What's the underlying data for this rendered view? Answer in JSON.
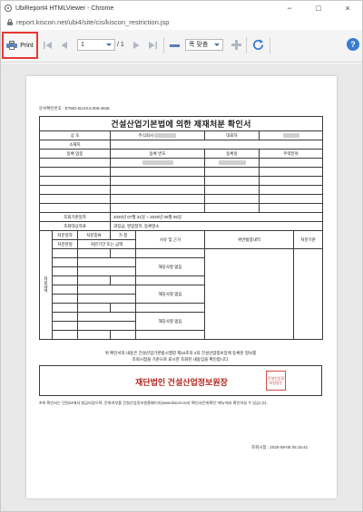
{
  "window": {
    "title": "UbiReport4 HTMLViewer - Chrome",
    "controls": {
      "minimize": "−",
      "maximize": "□",
      "close": "×"
    }
  },
  "address_bar": {
    "url": "report.kiscon.net/ubi4/site/cis/kiscon_restriction.jsp"
  },
  "toolbar": {
    "print_label": "Print",
    "page_current": "1",
    "page_total": "/ 1",
    "zoom_label": "폭 맞춤",
    "icons": [
      "printer-icon",
      "first-page-icon",
      "prev-page-icon",
      "next-page-icon",
      "last-page-icon",
      "zoom-out-icon",
      "zoom-in-icon",
      "refresh-icon",
      "help-icon"
    ],
    "help_label": "?"
  },
  "document": {
    "doc_number": "문서확인번호 : ETMG-B1XX4-009-4846",
    "title": "건설산업기본법에 의한 제재처분 확인서",
    "company_row": {
      "trade_name_label": "상 호",
      "trade_name_prefix": "주식회사",
      "ceo_label": "대표자"
    },
    "address_label": "소재지",
    "registration_headers": [
      "등록 업종",
      "등록 번호",
      "등록일",
      "주력분야"
    ],
    "period_label": "조회기준일자",
    "period_value": "2020년 07월 31일 ~ 2020년 09월 05일",
    "target_label": "조회대상자료",
    "target_value": "과징금, 영업정지, 등록말소",
    "disposal_headers": {
      "side_label": "처분내역",
      "processing_date": "처분일자",
      "processing_type": "처분종류",
      "fine": "가 정",
      "processing_agency": "처분관청",
      "period_or_fine": "처분기간 또는 금액",
      "reason": "사유 및 근거",
      "violation": "위반법령내역",
      "status": "처분기준"
    },
    "row_labels": [
      "해당사항 없음",
      "해당사항 없음",
      "해당사항 없음"
    ],
    "notice_line1": "위 확인서의 내용은 건설산업기본법시행령 제10조의 2의 건설산업정보망에 등록된 정보를",
    "notice_line2": "조회시점을 기준으로 표시한 조회된 내용임을 확인합니다.",
    "organization": "재단법인 건설산업정보원장",
    "seal_text": "건설산업정보원장인",
    "footnote": "※위 확인서는 민원24에서 발급되었으며, 진위여부를 건설산업정보원홈페이지(www.kiscon.net) '확인서진위확인' 메뉴에서 확인하실 수 있습니다.",
    "print_date": "조회시점 : 2020-09-05 05:15:41"
  }
}
